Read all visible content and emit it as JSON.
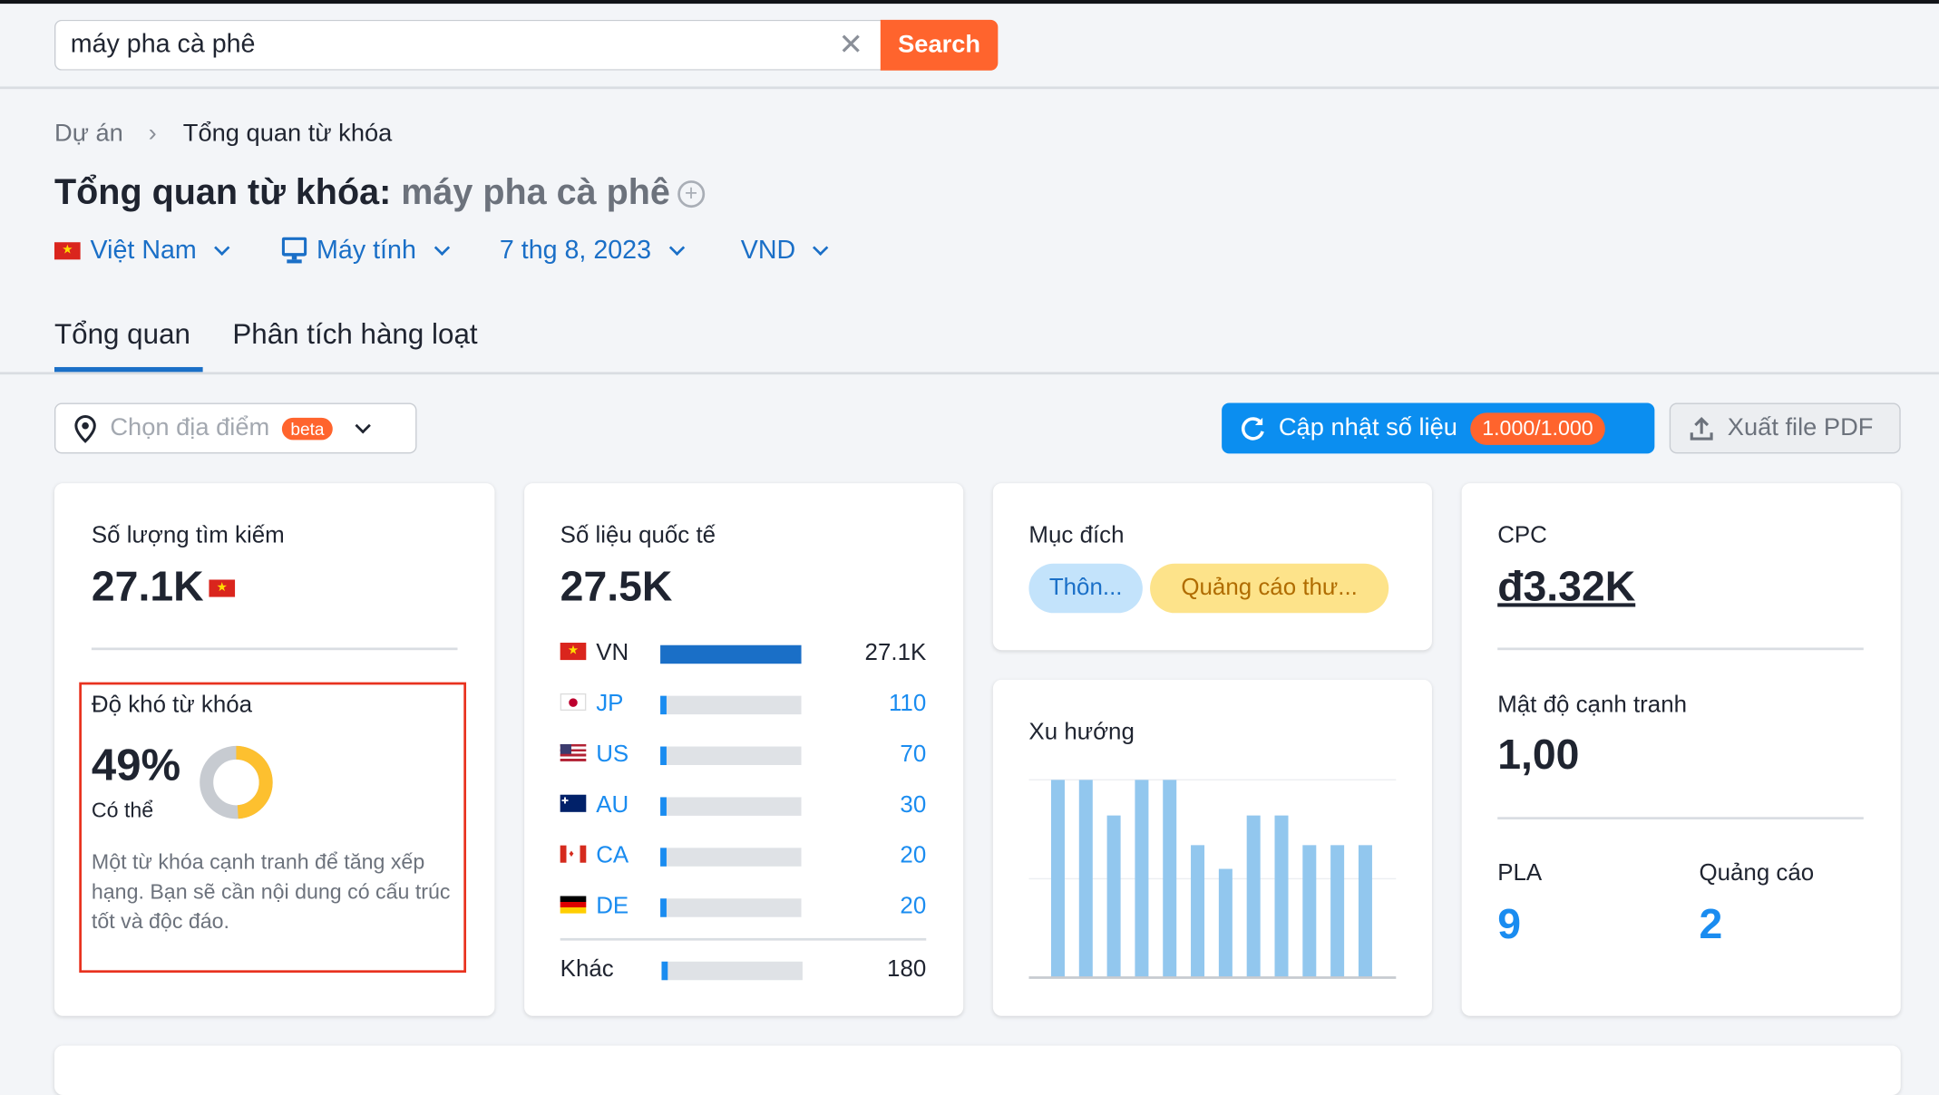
{
  "search": {
    "value": "máy pha cà phê",
    "button": "Search"
  },
  "breadcrumb": [
    "Dự án",
    "Tổng quan từ khóa"
  ],
  "title": {
    "label": "Tổng quan từ khóa:",
    "keyword": "máy pha cà phê"
  },
  "filters": {
    "country": "Việt Nam",
    "device": "Máy tính",
    "date": "7 thg 8, 2023",
    "currency": "VND"
  },
  "tabs": [
    "Tổng quan",
    "Phân tích hàng loạt"
  ],
  "location": {
    "placeholder": "Chọn địa điểm",
    "badge": "beta"
  },
  "update": {
    "label": "Cập nhật số liệu",
    "quota": "1.000/1.000"
  },
  "export": {
    "label": "Xuất file PDF"
  },
  "volume": {
    "label": "Số lượng tìm kiếm",
    "value": "27.1K"
  },
  "difficulty": {
    "label": "Độ khó từ khóa",
    "value": "49%",
    "percent": 49,
    "level": "Có thể",
    "description": "Một từ khóa cạnh tranh để tăng xếp hạng. Bạn sẽ cần nội dung có cấu trúc tốt và độc đáo.",
    "color": "#fdc02f"
  },
  "global": {
    "label": "Số liệu quốc tế",
    "value": "27.5K",
    "rows": [
      {
        "code": "VN",
        "value": "27.1K",
        "share": 1
      },
      {
        "code": "JP",
        "value": "110",
        "share": 0.04
      },
      {
        "code": "US",
        "value": "70",
        "share": 0.04
      },
      {
        "code": "AU",
        "value": "30",
        "share": 0.04
      },
      {
        "code": "CA",
        "value": "20",
        "share": 0.04
      },
      {
        "code": "DE",
        "value": "20",
        "share": 0.04
      }
    ],
    "other": {
      "label": "Khác",
      "value": "180",
      "share": 0.04
    }
  },
  "intent": {
    "label": "Mục đích",
    "tags": [
      "Thôn...",
      "Quảng cáo thư..."
    ]
  },
  "trend": {
    "label": "Xu hướng",
    "values": [
      100,
      100,
      82,
      100,
      100,
      67,
      55,
      82,
      82,
      67,
      67,
      67
    ]
  },
  "cpc": {
    "label": "CPC",
    "value": "đ3.32K"
  },
  "competition": {
    "label": "Mật độ cạnh tranh",
    "value": "1,00"
  },
  "pla": {
    "label": "PLA",
    "value": "9"
  },
  "ads": {
    "label": "Quảng cáo",
    "value": "2"
  },
  "colors": {
    "accent": "#1a8cf0",
    "orange": "#ff642d",
    "trend_bar": "#92c7ee"
  }
}
